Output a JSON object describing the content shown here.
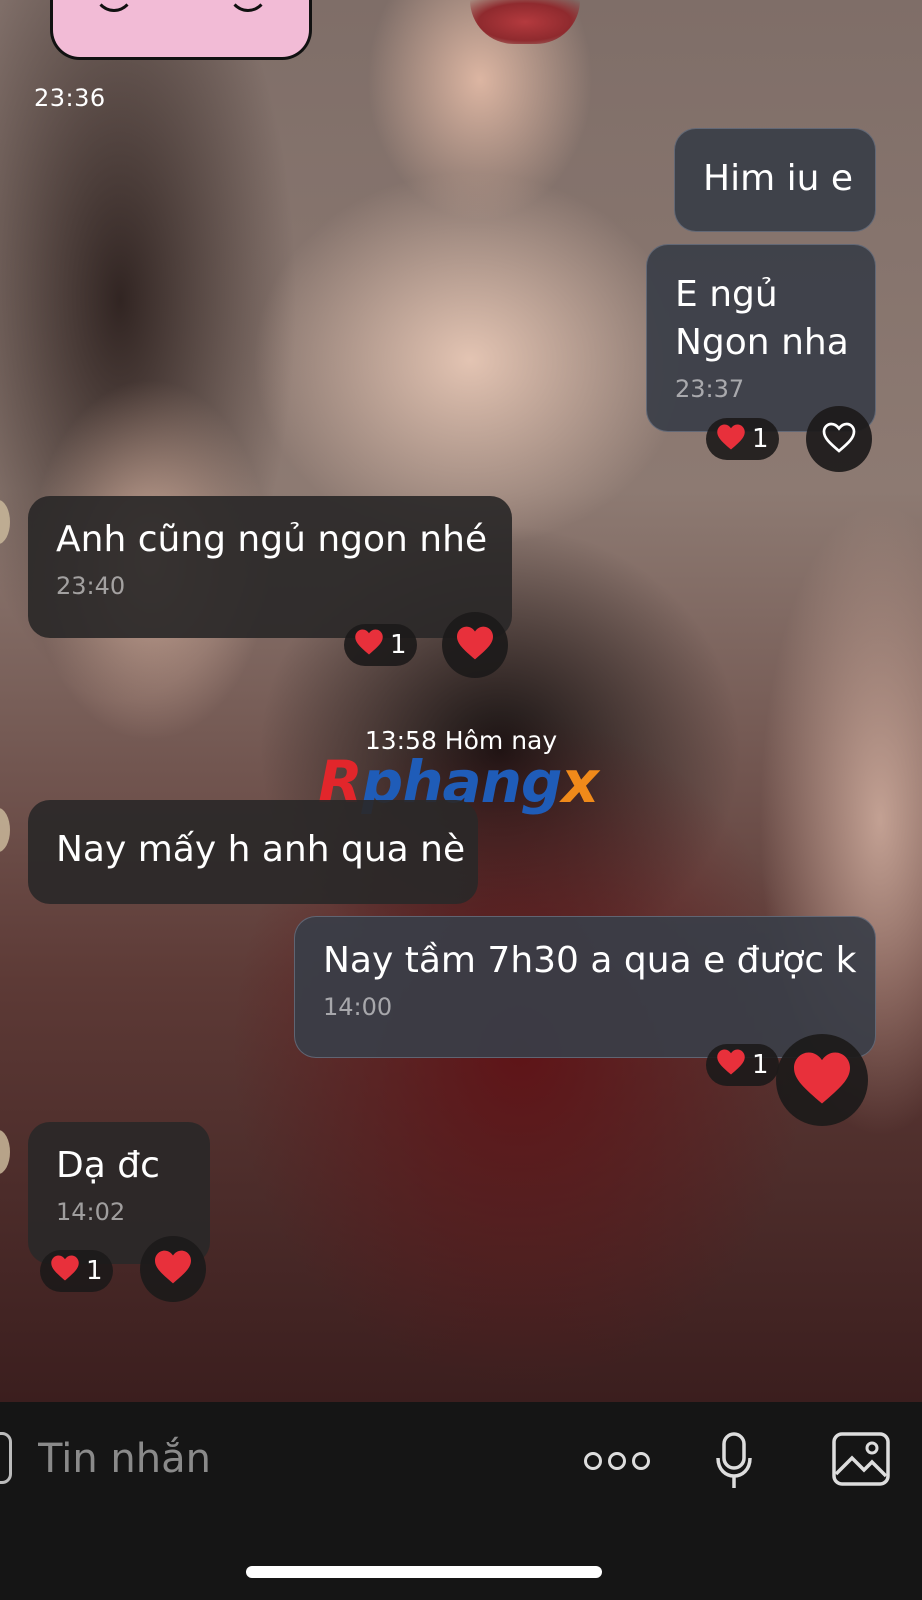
{
  "chat": {
    "top_timestamp": "23:36",
    "date_separator": "13:58 Hôm nay",
    "watermark": {
      "part_r": "R",
      "part_mid": "phang",
      "part_x": "x"
    },
    "messages": [
      {
        "direction": "outgoing",
        "text": "Him iu e",
        "time": ""
      },
      {
        "direction": "outgoing",
        "text": "E ngủ\nNgon nha",
        "line1": "E ngủ",
        "line2": "Ngon nha",
        "time": "23:37",
        "reaction_count": "1",
        "reaction_emoji": "heart",
        "react_button": "heart-outline"
      },
      {
        "direction": "incoming",
        "text": "Anh cũng ngủ ngon nhé",
        "time": "23:40",
        "reaction_count": "1",
        "reaction_emoji": "heart",
        "react_button": "heart-filled"
      },
      {
        "direction": "incoming",
        "text": "Nay mấy h anh qua nè",
        "time": ""
      },
      {
        "direction": "outgoing",
        "text": "Nay tầm 7h30 a qua e được k",
        "time": "14:00",
        "reaction_count": "1",
        "reaction_emoji": "heart",
        "react_button": "heart-filled"
      },
      {
        "direction": "incoming",
        "text": "Dạ đc",
        "time": "14:02",
        "reaction_count": "1",
        "reaction_emoji": "heart",
        "react_button": "heart-filled"
      }
    ]
  },
  "composer": {
    "placeholder": "Tin nhắn",
    "icons": [
      "attach-icon",
      "more-options-icon",
      "microphone-icon",
      "image-icon"
    ]
  },
  "colors": {
    "heart": "#e8303b",
    "incoming_bubble": "#2a2828",
    "outgoing_bubble": "#3a3e48",
    "composer_bg": "#151515"
  }
}
